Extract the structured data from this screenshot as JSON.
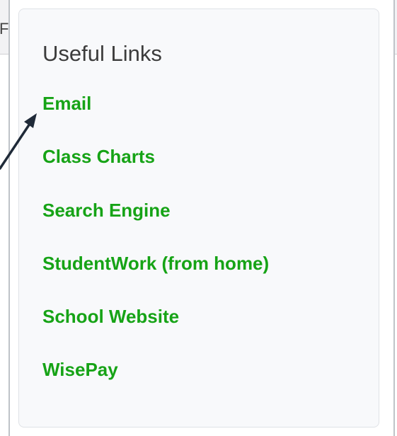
{
  "background": {
    "partial_text": "Fo"
  },
  "panel": {
    "title": "Useful Links",
    "links": [
      {
        "label": "Email"
      },
      {
        "label": "Class Charts"
      },
      {
        "label": "Search Engine"
      },
      {
        "label": "StudentWork (from home)"
      },
      {
        "label": "School Website"
      },
      {
        "label": "WisePay"
      }
    ]
  },
  "colors": {
    "link": "#16a316",
    "title": "#3c3c3c",
    "arrow": "#1f2a38"
  },
  "annotation": {
    "type": "arrow",
    "points_to": "Email"
  }
}
